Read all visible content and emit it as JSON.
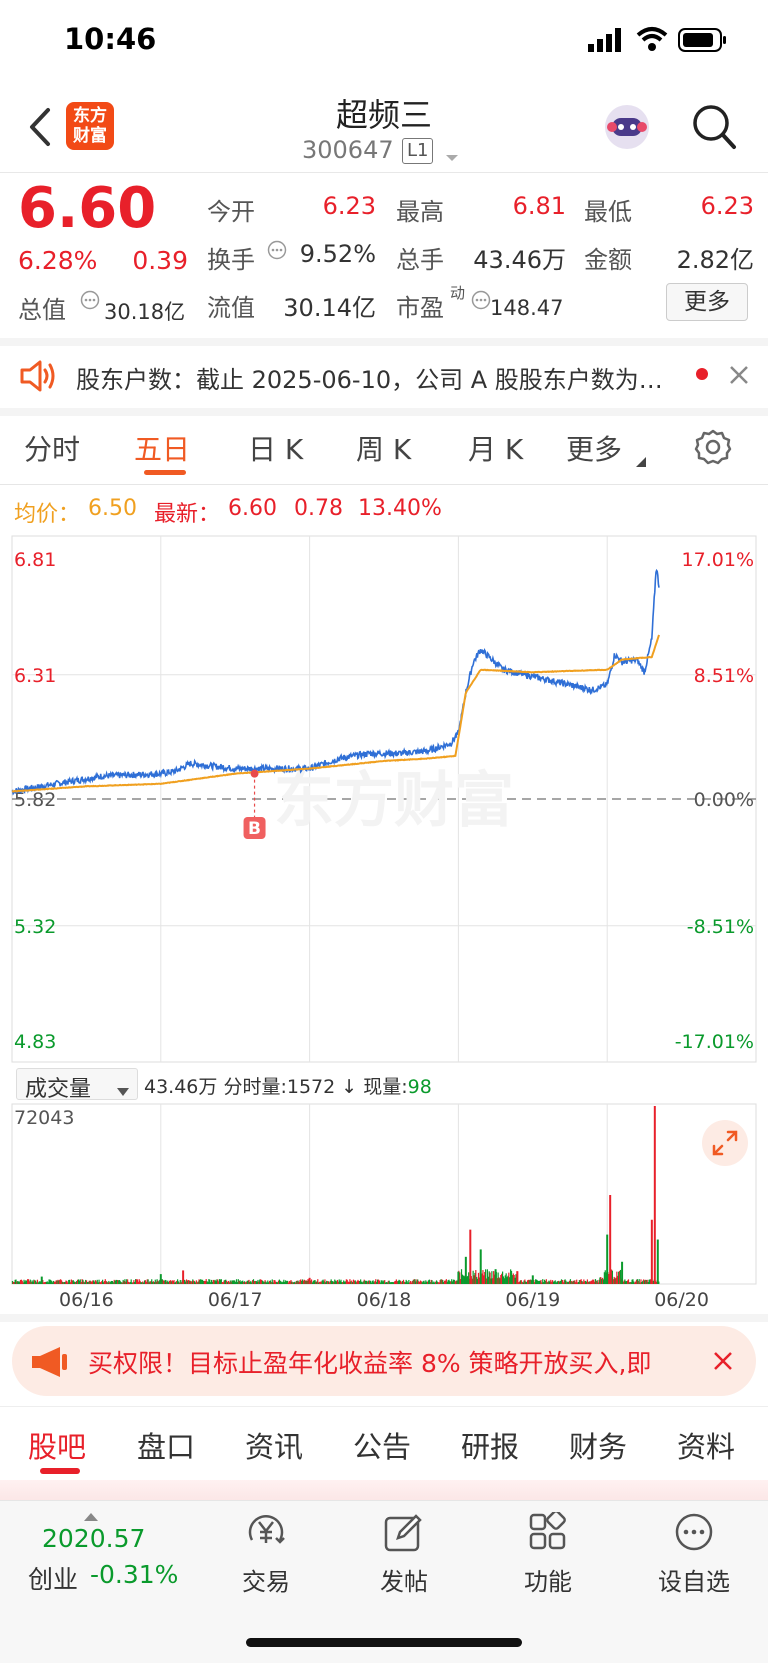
{
  "status": {
    "time": "10:46"
  },
  "header": {
    "logo_top": "东方",
    "logo_bottom": "财富",
    "name": "超频三",
    "code": "300647",
    "level": "L1"
  },
  "quote": {
    "price": "6.60",
    "change_pct": "6.28%",
    "change_amt": "0.39",
    "total_value_label": "总值",
    "total_value": "30.18亿",
    "more_label": "更多",
    "stats": {
      "open_label": "今开",
      "open": "6.23",
      "high_label": "最高",
      "high": "6.81",
      "low_label": "最低",
      "low": "6.23",
      "turnover_label": "换手",
      "turnover": "9.52%",
      "volume_label": "总手",
      "volume": "43.46万",
      "amount_label": "金额",
      "amount": "2.82亿",
      "float_label": "流值",
      "float_value": "30.14亿",
      "pe_label": "市盈",
      "pe_super": "动",
      "pe": "148.47"
    }
  },
  "notice": {
    "text": "股东户数：截止 2025-06-10，公司 A 股股东户数为…"
  },
  "period_tabs": [
    "分时",
    "五日",
    "日 K",
    "周 K",
    "月 K",
    "更多"
  ],
  "chart_data": {
    "type": "line",
    "legend": {
      "avg_label": "均价：",
      "avg": "6.50",
      "latest_label": "最新：",
      "latest": "6.60",
      "change": "0.78",
      "change_pct": "13.40%"
    },
    "y_left_ticks": [
      "6.81",
      "6.31",
      "5.82",
      "5.32",
      "4.83"
    ],
    "y_right_ticks": [
      "17.01%",
      "8.51%",
      "0.00%",
      "-8.51%",
      "-17.01%"
    ],
    "ylim": [
      4.83,
      6.81
    ],
    "baseline": 5.82,
    "x_ticks": [
      "06/16",
      "06/17",
      "06/18",
      "06/19",
      "06/20"
    ],
    "watermark": "东方财富",
    "marker": {
      "label": "B",
      "day_index": 1.63,
      "price": 5.92
    },
    "series": [
      {
        "color": "#2f6fd6",
        "anchors": [
          [
            0,
            5.85
          ],
          [
            0.3,
            5.88
          ],
          [
            0.6,
            5.91
          ],
          [
            1.0,
            5.92
          ],
          [
            1.1,
            5.93
          ],
          [
            1.2,
            5.96
          ],
          [
            1.5,
            5.94
          ],
          [
            2.0,
            5.94
          ],
          [
            2.2,
            5.98
          ],
          [
            2.4,
            6.0
          ],
          [
            2.6,
            6.0
          ],
          [
            2.8,
            6.01
          ],
          [
            2.95,
            6.04
          ],
          [
            3.0,
            6.08
          ],
          [
            3.05,
            6.24
          ],
          [
            3.1,
            6.36
          ],
          [
            3.15,
            6.41
          ],
          [
            3.3,
            6.33
          ],
          [
            3.6,
            6.29
          ],
          [
            3.9,
            6.25
          ],
          [
            4.0,
            6.27
          ],
          [
            4.05,
            6.39
          ],
          [
            4.1,
            6.36
          ],
          [
            4.2,
            6.37
          ],
          [
            4.25,
            6.32
          ],
          [
            4.3,
            6.45
          ],
          [
            4.33,
            6.74
          ],
          [
            4.35,
            6.65
          ]
        ]
      },
      {
        "color": "#f0a020",
        "anchors": [
          [
            0,
            5.85
          ],
          [
            0.5,
            5.87
          ],
          [
            1.0,
            5.88
          ],
          [
            1.5,
            5.92
          ],
          [
            2.0,
            5.94
          ],
          [
            2.5,
            5.97
          ],
          [
            2.8,
            5.98
          ],
          [
            2.98,
            5.99
          ],
          [
            3.05,
            6.24
          ],
          [
            3.15,
            6.33
          ],
          [
            3.5,
            6.32
          ],
          [
            4.0,
            6.33
          ],
          [
            4.1,
            6.37
          ],
          [
            4.3,
            6.38
          ],
          [
            4.35,
            6.47
          ]
        ]
      }
    ],
    "volume": {
      "selector": "成交量",
      "total": "43.46万",
      "minute_label": "分时量:",
      "minute": "1572",
      "arrow": "↓",
      "current_label": "现量:",
      "current": "98",
      "max_tick": "72043",
      "spikes": [
        [
          0.2,
          3000,
          "g"
        ],
        [
          1.0,
          4000,
          "g"
        ],
        [
          1.15,
          5500,
          "r"
        ],
        [
          2.0,
          2500,
          "r"
        ],
        [
          3.0,
          5000,
          "g"
        ],
        [
          3.05,
          11000,
          "g"
        ],
        [
          3.08,
          22000,
          "r"
        ],
        [
          3.15,
          14000,
          "g"
        ],
        [
          3.25,
          6000,
          "g"
        ],
        [
          3.5,
          3500,
          "g"
        ],
        [
          4.0,
          20000,
          "g"
        ],
        [
          4.02,
          36000,
          "r"
        ],
        [
          4.1,
          9000,
          "g"
        ],
        [
          4.3,
          26000,
          "r"
        ],
        [
          4.32,
          72043,
          "r"
        ],
        [
          4.34,
          18000,
          "g"
        ]
      ]
    }
  },
  "promo": {
    "text": "买权限！目标止盈年化收益率 8% 策略开放买入,即"
  },
  "content_tabs": [
    "股吧",
    "盘口",
    "资讯",
    "公告",
    "研报",
    "财务",
    "资料"
  ],
  "bottom_bar": {
    "index_value": "2020.57",
    "index_name": "创业",
    "index_change": "-0.31%",
    "items": [
      "交易",
      "发帖",
      "功能",
      "设自选"
    ]
  }
}
